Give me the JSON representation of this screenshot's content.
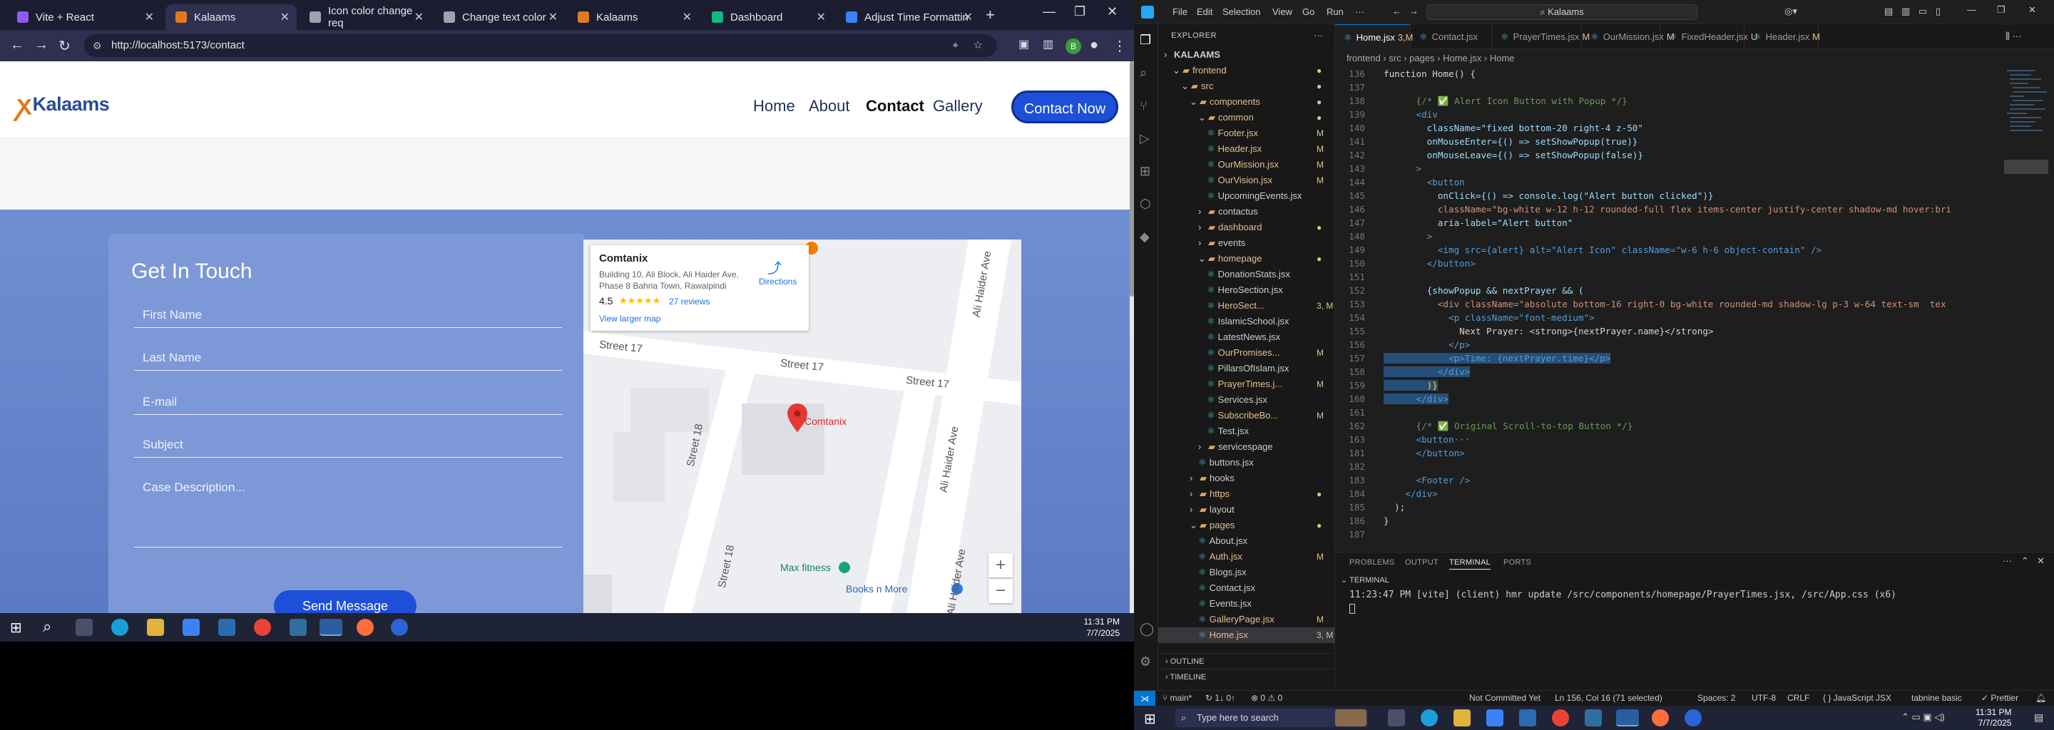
{
  "chrome": {
    "tabs": [
      {
        "label": "Vite + React",
        "color": "#8b5cf6"
      },
      {
        "label": "Kalaams",
        "color": "#e07a1f"
      },
      {
        "label": "Icon color change req",
        "color": "#9ca3af"
      },
      {
        "label": "Change text color",
        "color": "#9ca3af"
      },
      {
        "label": "Kalaams",
        "color": "#e07a1f"
      },
      {
        "label": "Dashboard",
        "color": "#10b981"
      },
      {
        "label": "Adjust Time Formattin",
        "color": "#3b82f6"
      }
    ],
    "new_tab": "+",
    "url": "http://localhost:5173/contact",
    "profile_initial": "B"
  },
  "site": {
    "logo_text": "Kalaams",
    "nav": [
      "Home",
      "About",
      "Contact",
      "Gallery"
    ],
    "cta": "Contact Now",
    "form": {
      "title": "Get In Touch",
      "first_name": "First Name",
      "last_name": "Last Name",
      "email": "E-mail",
      "subject": "Subject",
      "description": "Case Description...",
      "send": "Send Message"
    },
    "map": {
      "place_name": "Comtanix",
      "address_1": "Building 10, Ali Block, Ali Haider Ave,",
      "address_2": "Phase 8 Bahria Town, Rawalpindi",
      "rating": "4.5",
      "stars": "★★★★★",
      "reviews": "27 reviews",
      "directions": "Directions",
      "view_larger": "View larger map",
      "pin_label": "Comtanix",
      "street_17a": "Street 17",
      "street_17b": "Street 17",
      "street_17c": "Street 17",
      "street_18": "Street 18",
      "street_18b": "Street 18",
      "ali_haider_a": "Ali Haider Ave",
      "ali_haider_b": "Ali Haider Ave",
      "ali_haider_c": "Ali Haider Ave",
      "poi_1": "Max fitness",
      "poi_2": "Books n More",
      "zoom_in": "+",
      "zoom_out": "−"
    }
  },
  "taskbar_left": {
    "time": "11:31 PM",
    "date": "7/7/2025"
  },
  "vscode": {
    "menus": [
      "File",
      "Edit",
      "Selection",
      "View",
      "Go",
      "Run",
      "···"
    ],
    "command_center": "Kalaams",
    "explorer_title": "EXPLORER",
    "tree": [
      {
        "label": "KALAAMS",
        "depth": 0,
        "type": "root"
      },
      {
        "label": "frontend",
        "depth": 1,
        "type": "folder",
        "open": true,
        "mod": "●"
      },
      {
        "label": "src",
        "depth": 2,
        "type": "folder",
        "open": true,
        "mod": "●"
      },
      {
        "label": "components",
        "depth": 3,
        "type": "folder",
        "open": true,
        "mod": "●"
      },
      {
        "label": "common",
        "depth": 4,
        "type": "folder",
        "open": true,
        "mod": "●"
      },
      {
        "label": "Footer.jsx",
        "depth": 5,
        "type": "file",
        "mod": "M"
      },
      {
        "label": "Header.jsx",
        "depth": 5,
        "type": "file",
        "mod": "M"
      },
      {
        "label": "OurMission.jsx",
        "depth": 5,
        "type": "file",
        "mod": "M"
      },
      {
        "label": "OurVision.jsx",
        "depth": 5,
        "type": "file",
        "mod": "M"
      },
      {
        "label": "UpcomingEvents.jsx",
        "depth": 5,
        "type": "file",
        "mod": ""
      },
      {
        "label": "contactus",
        "depth": 4,
        "type": "folder",
        "open": false,
        "mod": ""
      },
      {
        "label": "dashboard",
        "depth": 4,
        "type": "folder",
        "open": false,
        "mod": "●"
      },
      {
        "label": "events",
        "depth": 4,
        "type": "folder",
        "open": false,
        "mod": ""
      },
      {
        "label": "homepage",
        "depth": 4,
        "type": "folder",
        "open": true,
        "mod": "●"
      },
      {
        "label": "DonationStats.jsx",
        "depth": 5,
        "type": "file",
        "mod": ""
      },
      {
        "label": "HeroSection.jsx",
        "depth": 5,
        "type": "file",
        "mod": ""
      },
      {
        "label": "HeroSect...",
        "depth": 5,
        "type": "file",
        "mod": "3, M"
      },
      {
        "label": "IslamicSchool.jsx",
        "depth": 5,
        "type": "file",
        "mod": ""
      },
      {
        "label": "LatestNews.jsx",
        "depth": 5,
        "type": "file",
        "mod": ""
      },
      {
        "label": "OurPromises...",
        "depth": 5,
        "type": "file",
        "mod": "M"
      },
      {
        "label": "PillarsOfIslam.jsx",
        "depth": 5,
        "type": "file",
        "mod": ""
      },
      {
        "label": "PrayerTimes.j...",
        "depth": 5,
        "type": "file",
        "mod": "M"
      },
      {
        "label": "Services.jsx",
        "depth": 5,
        "type": "file",
        "mod": ""
      },
      {
        "label": "SubscribeBo...",
        "depth": 5,
        "type": "file",
        "mod": "M"
      },
      {
        "label": "Test.jsx",
        "depth": 5,
        "type": "file",
        "mod": ""
      },
      {
        "label": "servicespage",
        "depth": 4,
        "type": "folder",
        "open": false,
        "mod": ""
      },
      {
        "label": "buttons.jsx",
        "depth": 4,
        "type": "file",
        "mod": ""
      },
      {
        "label": "hooks",
        "depth": 3,
        "type": "folder",
        "open": false,
        "mod": ""
      },
      {
        "label": "https",
        "depth": 3,
        "type": "folder",
        "open": false,
        "mod": "●"
      },
      {
        "label": "layout",
        "depth": 3,
        "type": "folder",
        "open": false,
        "mod": ""
      },
      {
        "label": "pages",
        "depth": 3,
        "type": "folder",
        "open": true,
        "mod": "●"
      },
      {
        "label": "About.jsx",
        "depth": 4,
        "type": "file",
        "mod": ""
      },
      {
        "label": "Auth.jsx",
        "depth": 4,
        "type": "file",
        "mod": "M"
      },
      {
        "label": "Blogs.jsx",
        "depth": 4,
        "type": "file",
        "mod": ""
      },
      {
        "label": "Contact.jsx",
        "depth": 4,
        "type": "file",
        "mod": ""
      },
      {
        "label": "Events.jsx",
        "depth": 4,
        "type": "file",
        "mod": ""
      },
      {
        "label": "GalleryPage.jsx",
        "depth": 4,
        "type": "file",
        "mod": "M"
      },
      {
        "label": "Home.jsx",
        "depth": 4,
        "type": "file",
        "mod": "3, M",
        "selected": true
      }
    ],
    "outline": "OUTLINE",
    "timeline": "TIMELINE",
    "editor_tabs": [
      {
        "label": "Home.jsx",
        "suffix": "3,M",
        "active": true
      },
      {
        "label": "Contact.jsx",
        "suffix": "",
        "active": false
      },
      {
        "label": "PrayerTimes.jsx",
        "suffix": "M",
        "active": false
      },
      {
        "label": "OurMission.jsx",
        "suffix": "M",
        "active": false
      },
      {
        "label": "FixedHeader.jsx",
        "suffix": "U",
        "active": false
      },
      {
        "label": "Header.jsx",
        "suffix": "M",
        "active": false
      }
    ],
    "breadcrumb": "frontend › src › pages › Home.jsx › Home",
    "code_lines": [
      {
        "n": "136",
        "t": "function Home() {",
        "cls": "c-txt"
      },
      {
        "n": "137",
        "t": "",
        "cls": "c-txt"
      },
      {
        "n": "138",
        "t": "      {/* ✅ Alert Icon Button with Popup */}",
        "cls": "c-com"
      },
      {
        "n": "139",
        "t": "      <div",
        "cls": "c-tag"
      },
      {
        "n": "140",
        "t": "        className=\"fixed bottom-20 right-4 z-50\"",
        "cls": "c-attr"
      },
      {
        "n": "141",
        "t": "        onMouseEnter={() => setShowPopup(true)}",
        "cls": "c-attr"
      },
      {
        "n": "142",
        "t": "        onMouseLeave={() => setShowPopup(false)}",
        "cls": "c-attr"
      },
      {
        "n": "143",
        "t": "      >",
        "cls": "c-tag"
      },
      {
        "n": "144",
        "t": "        <button",
        "cls": "c-tag"
      },
      {
        "n": "145",
        "t": "          onClick={() => console.log(\"Alert button clicked\")}",
        "cls": "c-attr"
      },
      {
        "n": "146",
        "t": "          className=\"bg-white w-12 h-12 rounded-full flex items-center justify-center shadow-md hover:bri",
        "cls": "c-str"
      },
      {
        "n": "147",
        "t": "          aria-label=\"Alert button\"",
        "cls": "c-attr"
      },
      {
        "n": "148",
        "t": "        >",
        "cls": "c-tag"
      },
      {
        "n": "149",
        "t": "          <img src={alert} alt=\"Alert Icon\" className=\"w-6 h-6 object-contain\" />",
        "cls": "c-tag"
      },
      {
        "n": "150",
        "t": "        </button>",
        "cls": "c-tag"
      },
      {
        "n": "151",
        "t": "",
        "cls": "c-txt"
      },
      {
        "n": "152",
        "t": "        {showPopup && nextPrayer && (",
        "cls": "c-attr"
      },
      {
        "n": "153",
        "t": "          <div className=\"absolute bottom-16 right-0 bg-white rounded-md shadow-lg p-3 w-64 text-sm  tex",
        "cls": "c-str"
      },
      {
        "n": "154",
        "t": "            <p className=\"font-medium\">",
        "cls": "c-tag"
      },
      {
        "n": "155",
        "t": "              Next Prayer: <strong>{nextPrayer.name}</strong>",
        "cls": "c-txt"
      },
      {
        "n": "156",
        "t": "            </p>",
        "cls": "c-tag"
      },
      {
        "n": "157",
        "t": "            <p>Time: {nextPrayer.time}</p>",
        "cls": "c-tag",
        "sel": true
      },
      {
        "n": "158",
        "t": "          </div>",
        "cls": "c-tag",
        "sel": true
      },
      {
        "n": "159",
        "t": "        )}",
        "cls": "c-br",
        "sel": true
      },
      {
        "n": "160",
        "t": "      </div>",
        "cls": "c-tag",
        "sel": true
      },
      {
        "n": "161",
        "t": "",
        "cls": "c-txt"
      },
      {
        "n": "162",
        "t": "      {/* ✅ Original Scroll-to-top Button */}",
        "cls": "c-com"
      },
      {
        "n": "163",
        "t": "      <button···",
        "cls": "c-tag"
      },
      {
        "n": "181",
        "t": "      </button>",
        "cls": "c-tag"
      },
      {
        "n": "182",
        "t": "",
        "cls": "c-txt"
      },
      {
        "n": "183",
        "t": "      <Footer />",
        "cls": "c-tag"
      },
      {
        "n": "184",
        "t": "    </div>",
        "cls": "c-tag"
      },
      {
        "n": "185",
        "t": "  );",
        "cls": "c-txt"
      },
      {
        "n": "186",
        "t": "}",
        "cls": "c-txt"
      },
      {
        "n": "187",
        "t": "",
        "cls": "c-txt"
      }
    ],
    "panel_tabs": [
      "PROBLEMS",
      "OUTPUT",
      "TERMINAL",
      "PORTS"
    ],
    "terminal_header": "TERMINAL",
    "terminal_text": "11:23:47 PM [vite] (client) hmr update /src/components/homepage/PrayerTimes.jsx, /src/App.css (x6)",
    "status": {
      "branch": "main*",
      "sync": "↻ 1↓ 0↑",
      "errors": "⊗ 0 ⚠ 0",
      "not_committed": "Not Committed Yet",
      "cursor": "Ln 156, Col 16 (71 selected)",
      "spaces": "Spaces: 2",
      "encoding": "UTF-8",
      "eol": "CRLF",
      "language": "{ } JavaScript JSX",
      "tabnine": "tabnine basic",
      "prettier": "✓ Prettier"
    }
  },
  "taskbar_right": {
    "search": "Type here to search",
    "time": "11:31 PM",
    "date": "7/7/2025"
  }
}
